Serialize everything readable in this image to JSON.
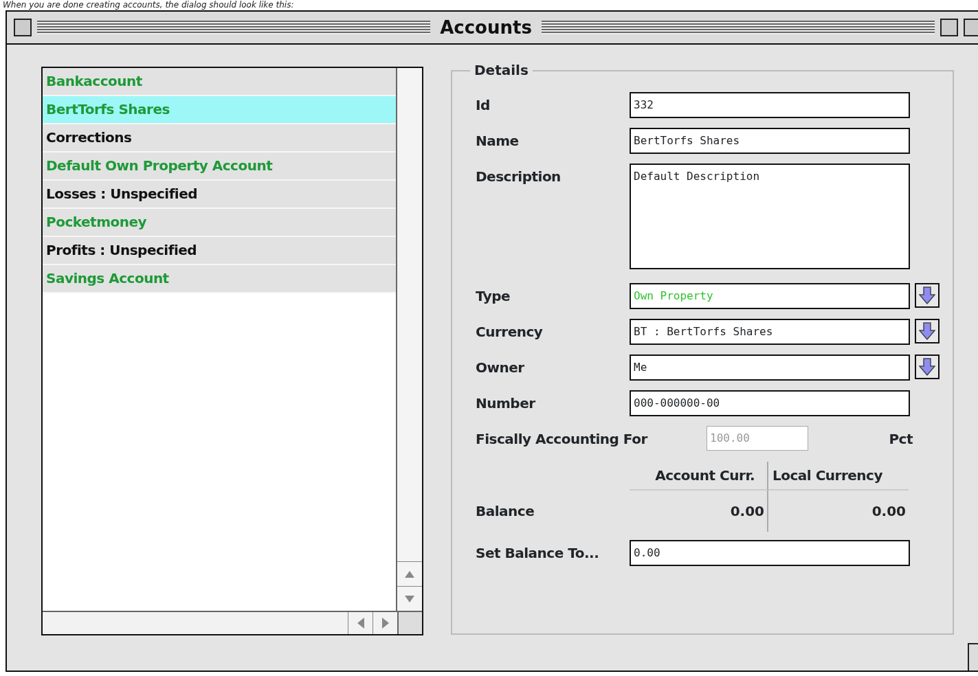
{
  "caption": "When you are done creating accounts, the dialog should look like this:",
  "window": {
    "title": "Accounts"
  },
  "accounts": [
    {
      "name": "Bankaccount",
      "color": "#1e9a38",
      "selected": false
    },
    {
      "name": "BertTorfs Shares",
      "color": "#1e9a38",
      "selected": true
    },
    {
      "name": "Corrections",
      "color": "#111111",
      "selected": false
    },
    {
      "name": "Default Own Property Account",
      "color": "#1e9a38",
      "selected": false
    },
    {
      "name": "Losses : Unspecified",
      "color": "#111111",
      "selected": false
    },
    {
      "name": "Pocketmoney",
      "color": "#1e9a38",
      "selected": false
    },
    {
      "name": "Profits : Unspecified",
      "color": "#111111",
      "selected": false
    },
    {
      "name": "Savings Account",
      "color": "#1e9a38",
      "selected": false
    }
  ],
  "details": {
    "title": "Details",
    "fields": [
      {
        "kind": "text",
        "label": "Id",
        "value": "332"
      },
      {
        "kind": "text",
        "label": "Name",
        "value": "BertTorfs Shares"
      },
      {
        "kind": "textarea",
        "label": "Description",
        "value": "Default Description"
      },
      {
        "kind": "dropdown",
        "label": "Type",
        "value": "Own Property",
        "color": "#2fc22f"
      },
      {
        "kind": "dropdown",
        "label": "Currency",
        "value": "BT : BertTorfs Shares"
      },
      {
        "kind": "dropdown",
        "label": "Owner",
        "value": "Me"
      },
      {
        "kind": "text",
        "label": "Number",
        "value": "000-000000-00"
      }
    ],
    "fiscal": {
      "label": "Fiscally Accounting For",
      "value": "100.00",
      "disabled": true,
      "unit": "Pct"
    },
    "balance": {
      "columns": [
        "Account Curr.",
        "Local Currency"
      ],
      "label": "Balance",
      "values": [
        "0.00",
        "0.00"
      ]
    },
    "set_balance": {
      "label": "Set Balance To...",
      "value": "0.00"
    }
  }
}
